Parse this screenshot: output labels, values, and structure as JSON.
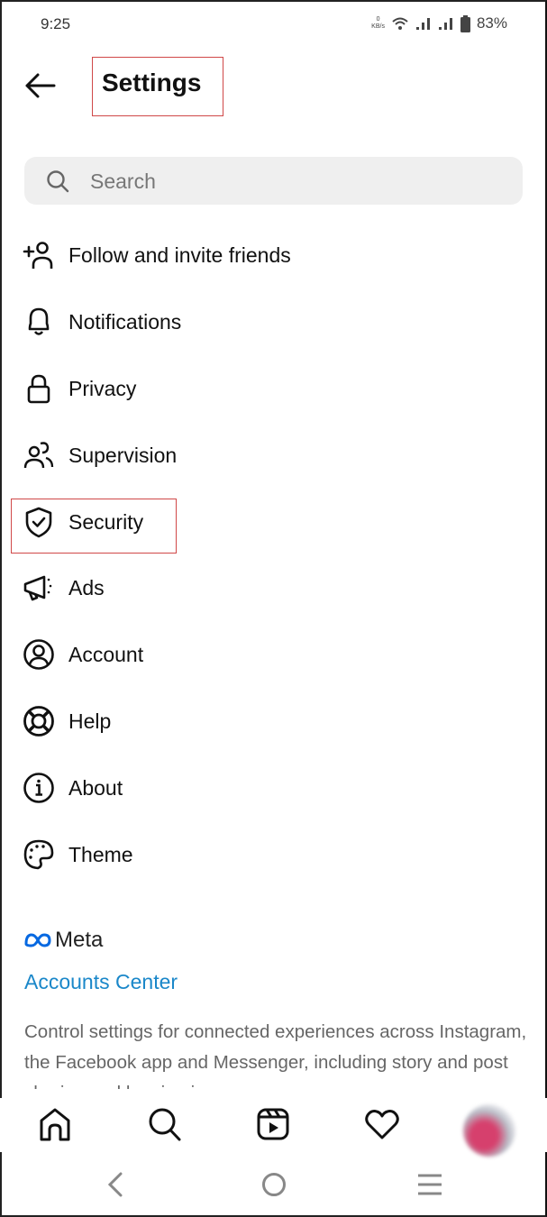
{
  "status_bar": {
    "time": "9:25",
    "net_speed_value": "0",
    "net_speed_unit": "KB/s",
    "icons": [
      "wifi-icon",
      "signal-icon",
      "signal-icon",
      "battery-icon"
    ],
    "battery": "83%"
  },
  "header": {
    "back_icon": "arrow-left-icon",
    "title": "Settings"
  },
  "search": {
    "icon": "search-icon",
    "placeholder": "Search"
  },
  "menu": {
    "items": [
      {
        "label": "Follow and invite friends",
        "icon": "add-person-icon"
      },
      {
        "label": "Notifications",
        "icon": "bell-icon"
      },
      {
        "label": "Privacy",
        "icon": "lock-icon"
      },
      {
        "label": "Supervision",
        "icon": "people-icon"
      },
      {
        "label": "Security",
        "icon": "shield-check-icon"
      },
      {
        "label": "Ads",
        "icon": "megaphone-icon"
      },
      {
        "label": "Account",
        "icon": "user-circle-icon"
      },
      {
        "label": "Help",
        "icon": "lifebuoy-icon"
      },
      {
        "label": "About",
        "icon": "info-icon"
      },
      {
        "label": "Theme",
        "icon": "palette-icon"
      }
    ]
  },
  "meta_section": {
    "brand": "Meta",
    "brand_color": "#0668E1",
    "link": "Accounts Center",
    "link_color": "#1a87c9",
    "description": "Control settings for connected experiences across Instagram, the Facebook app and Messenger, including story and post sharing and logging in."
  },
  "bottom_nav": {
    "items": [
      "home-icon",
      "search-icon",
      "reels-icon",
      "heart-icon",
      "profile-avatar"
    ]
  },
  "system_nav": {
    "items": [
      "back-icon",
      "home-circle-icon",
      "menu-icon"
    ]
  },
  "annotations": {
    "highlight_color": "#d04848",
    "highlighted": [
      "Settings",
      "Security"
    ]
  }
}
